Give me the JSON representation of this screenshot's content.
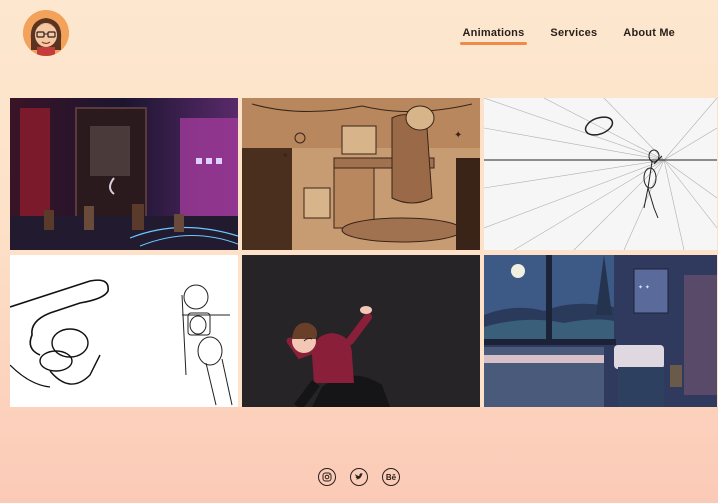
{
  "header": {
    "logo_icon": "cartoon-avatar-icon"
  },
  "nav": {
    "items": [
      {
        "label": "Animations",
        "active": true
      },
      {
        "label": "Services",
        "active": false
      },
      {
        "label": "About Me",
        "active": false
      }
    ],
    "accent_color": "#f08a4b"
  },
  "gallery": {
    "items": [
      {
        "name": "dark-room-3d-render",
        "depicts": "neon-lit-room-3d-render"
      },
      {
        "name": "sepia-desk-sketch",
        "depicts": "person-at-desk-sketch"
      },
      {
        "name": "perspective-grid-sketch",
        "depicts": "figure-throwing-ring-perspective-sketch"
      },
      {
        "name": "pointing-hand-lineart",
        "depicts": "pointing-hand-and-robot-lineart"
      },
      {
        "name": "dab-character-animation",
        "depicts": "character-dabbing-dark-background"
      },
      {
        "name": "night-bedroom-illustration",
        "depicts": "bedroom-window-night-scene"
      }
    ]
  },
  "footer": {
    "social_icons": [
      "instagram-icon",
      "twitter-icon",
      "behance-icon"
    ],
    "behance_label": "Bē"
  },
  "colors": {
    "background_top": "#fde7cf",
    "background_bottom": "#fbcab7",
    "text": "#2a1f1a"
  }
}
